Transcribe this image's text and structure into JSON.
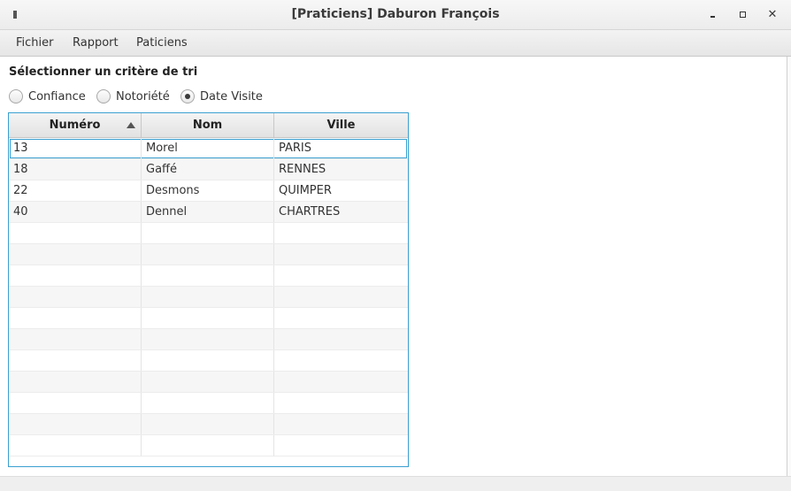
{
  "window": {
    "title": "[Praticiens] Daburon François",
    "minimize_icon": "minimize-icon",
    "maximize_icon": "maximize-icon",
    "close_icon": "close-icon"
  },
  "menu": {
    "items": [
      "Fichier",
      "Rapport",
      "Paticiens"
    ]
  },
  "sort_panel": {
    "label": "Sélectionner un critère de tri",
    "options": [
      "Confiance",
      "Notoriété",
      "Date Visite"
    ],
    "selected": "Date Visite"
  },
  "table": {
    "columns": [
      "Numéro",
      "Nom",
      "Ville"
    ],
    "sorted_column": "Numéro",
    "sort_direction": "ascending",
    "rows": [
      [
        "13",
        "Morel",
        "PARIS"
      ],
      [
        "18",
        "Gaffé",
        "RENNES"
      ],
      [
        "22",
        "Desmons",
        "QUIMPER"
      ],
      [
        "40",
        "Dennel",
        "CHARTRES"
      ]
    ],
    "selected_row": 0
  },
  "colors": {
    "accent": "#3aa0d0"
  }
}
